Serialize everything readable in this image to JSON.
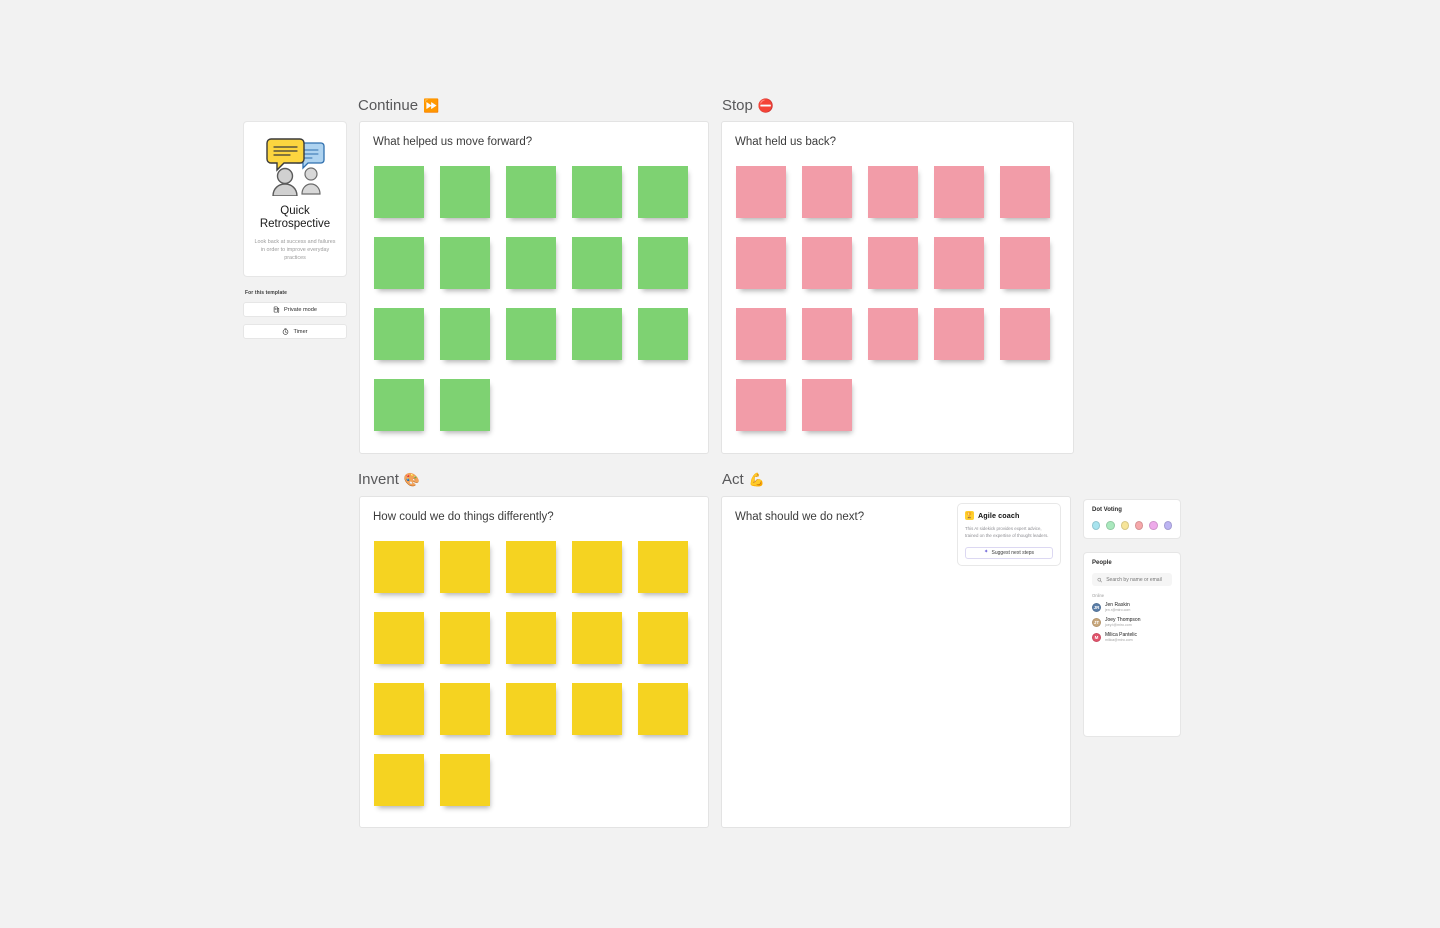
{
  "template_card": {
    "title": "Quick Retrospective",
    "description": "Look back at success and failures in order to improve everyday practices",
    "section_label": "For this template",
    "buttons": [
      {
        "label": "Private mode",
        "icon": "private-mode-icon"
      },
      {
        "label": "Timer",
        "icon": "timer-icon"
      }
    ]
  },
  "columns": [
    {
      "id": "continue",
      "title": "Continue",
      "emoji": "⏩",
      "question": "What helped us move forward?",
      "note_color": "green",
      "note_color_hex": "#7ed272",
      "note_count": 17,
      "note_rows": [
        5,
        5,
        5,
        2
      ]
    },
    {
      "id": "stop",
      "title": "Stop",
      "emoji": "⛔",
      "question": "What held us back?",
      "note_color": "pink",
      "note_color_hex": "#f29ca8",
      "note_count": 17,
      "note_rows": [
        5,
        5,
        5,
        2
      ]
    },
    {
      "id": "invent",
      "title": "Invent",
      "emoji": "🎨",
      "question": "How could we do things differently?",
      "note_color": "yellow",
      "note_color_hex": "#f5d321",
      "note_count": 17,
      "note_rows": [
        5,
        5,
        5,
        2
      ]
    },
    {
      "id": "act",
      "title": "Act",
      "emoji": "💪",
      "question": "What should we do next?",
      "note_color": "none",
      "note_color_hex": "",
      "note_count": 0,
      "note_rows": []
    }
  ],
  "agile_coach": {
    "title": "Agile coach",
    "badge_emoji": "🏆",
    "description": "This AI sidekick provides expert advice, trained on the expertise of thought leaders.",
    "button_label": "Suggest next steps"
  },
  "dot_voting": {
    "title": "Dot Voting",
    "colors": [
      "#a8e4ef",
      "#a9e8bd",
      "#f7e59a",
      "#f6a8aa",
      "#eeaaea",
      "#bcb4f2"
    ]
  },
  "people": {
    "title": "People",
    "search_placeholder": "Search by name or email",
    "search_value": "",
    "search_icon": "search-icon",
    "online_label": "Online",
    "list": [
      {
        "name": "Jen Raskin",
        "email": "jen.r@miro.com",
        "initials": "JR",
        "color": "#5b7ea8"
      },
      {
        "name": "Joey Thompson",
        "email": "joey.t@miro.com",
        "initials": "JT",
        "color": "#c9a87c"
      },
      {
        "name": "Milica Pantelic",
        "email": "milica@miro.com",
        "initials": "M",
        "color": "#e2546c"
      }
    ]
  }
}
